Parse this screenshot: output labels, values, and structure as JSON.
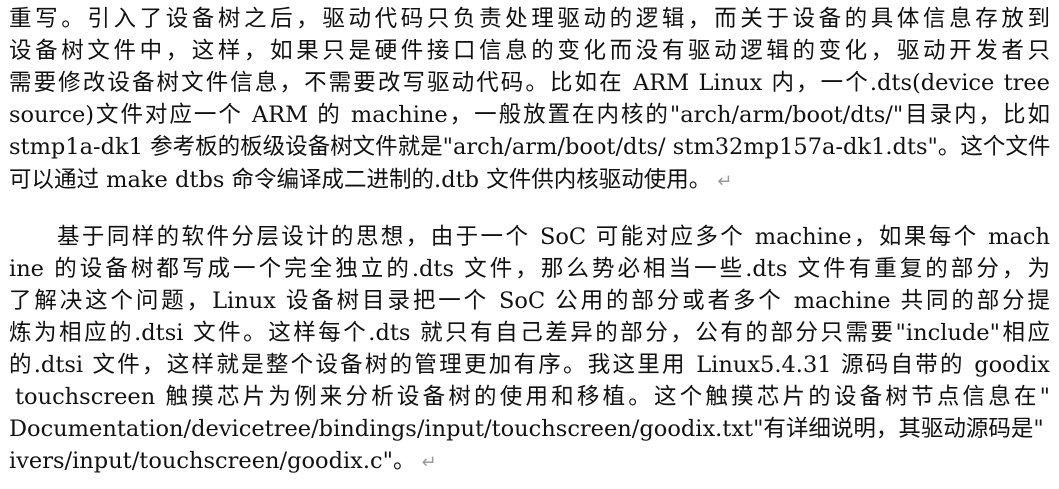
{
  "document": {
    "paragraphs": [
      {
        "lines": [
          "重写。引入了设备树之后，驱动代码只负责处理驱动的逻辑，而关于设备的具体信息存放到",
          "设备树文件中，这样，如果只是硬件接口信息的变化而没有驱动逻辑的变化，驱动开发者只",
          "需要修改设备树文件信息，不需要改写驱动代码。比如在 ARM Linux 内，一个.dts(device tree",
          "source)文件对应一个 ARM 的 machine，一般放置在内核的\"arch/arm/boot/dts/\"目录内，比如",
          "stmp1a-dk1 参考板的板级设备树文件就是\"arch/arm/boot/dts/ stm32mp157a-dk1.dts\"。这个文件",
          "可以通过 make dtbs 命令编译成二进制的.dtb 文件供内核驱动使用。"
        ],
        "end_mark": "↵"
      },
      {
        "lines": [
          "基于同样的软件分层设计的思想，由于一个 SoC 可能对应多个 machine，如果每个 mach",
          "ine 的设备树都写成一个完全独立的.dts 文件，那么势必相当一些.dts 文件有重复的部分，为",
          "了解决这个问题，Linux 设备树目录把一个 SoC 公用的部分或者多个 machine 共同的部分提",
          "炼为相应的.dtsi 文件。这样每个.dts 就只有自己差异的部分，公有的部分只需要\"include\"相应",
          "的.dtsi 文件，这样就是整个设备树的管理更加有序。我这里用 Linux5.4.31 源码自带的 goodix",
          "touchscreen 触摸芯片为例来分析设备树的使用和移植。这个触摸芯片的设备树节点信息在\"",
          "Documentation/devicetree/bindings/input/touchscreen/goodix.txt\"有详细说明，其驱动源码是\" dr",
          "ivers/input/touchscreen/goodix.c\"。"
        ],
        "end_mark": "↵"
      }
    ]
  }
}
